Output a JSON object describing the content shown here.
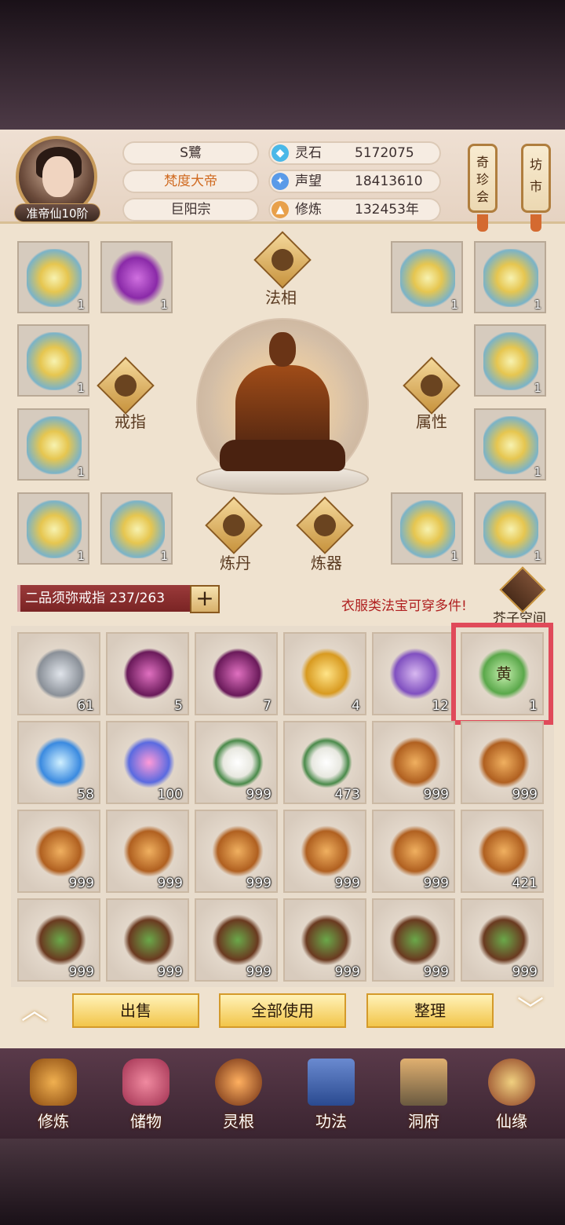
{
  "header": {
    "rank": "准帝仙10阶",
    "player_name": "S鷺",
    "title": "梵度大帝",
    "sect": "巨阳宗",
    "stats": [
      {
        "label": "灵石",
        "value": "5172075",
        "icon": "spirit-stone-icon"
      },
      {
        "label": "声望",
        "value": "18413610",
        "icon": "reputation-icon"
      },
      {
        "label": "修炼",
        "value": "132453年",
        "icon": "cultivation-icon"
      }
    ],
    "shortcuts": [
      "奇珍会",
      "坊市"
    ]
  },
  "equipment": {
    "slots": [
      {
        "count": "1"
      },
      {
        "count": "1"
      },
      {
        "count": "1"
      },
      {
        "count": "1"
      },
      {
        "count": "1"
      },
      {
        "count": "1"
      },
      {
        "count": "1"
      },
      {
        "count": "1"
      },
      {
        "count": "1"
      },
      {
        "count": "1"
      },
      {
        "count": "1"
      },
      {
        "count": "1"
      }
    ],
    "functions": {
      "faxiang": "法相",
      "ring": "戒指",
      "attributes": "属性",
      "alchemy": "炼丹",
      "forging": "炼器"
    }
  },
  "bag": {
    "name": "二品须弥戒指",
    "capacity": "237/263",
    "add_label": "+",
    "hint": "衣服类法宝可穿多件!",
    "jiezi_label": "芥子空间",
    "items": [
      {
        "count": "61"
      },
      {
        "count": "5"
      },
      {
        "count": "7"
      },
      {
        "count": "4"
      },
      {
        "count": "12"
      },
      {
        "count": "1"
      },
      {
        "count": "58"
      },
      {
        "count": "100"
      },
      {
        "count": "999"
      },
      {
        "count": "473"
      },
      {
        "count": "999"
      },
      {
        "count": "999"
      },
      {
        "count": "999"
      },
      {
        "count": "999"
      },
      {
        "count": "999"
      },
      {
        "count": "999"
      },
      {
        "count": "999"
      },
      {
        "count": "421"
      },
      {
        "count": "999"
      },
      {
        "count": "999"
      },
      {
        "count": "999"
      },
      {
        "count": "999"
      },
      {
        "count": "999"
      },
      {
        "count": "999"
      }
    ],
    "flag_glyph": "黄"
  },
  "actions": {
    "sell": "出售",
    "use_all": "全部使用",
    "sort": "整理",
    "up": "︿",
    "down": "﹀"
  },
  "nav": {
    "items": [
      "修炼",
      "储物",
      "灵根",
      "功法",
      "洞府",
      "仙缘"
    ]
  }
}
